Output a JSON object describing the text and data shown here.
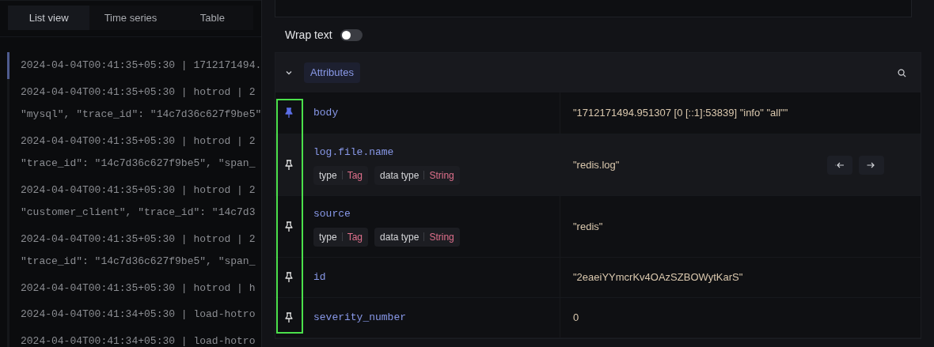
{
  "view_tabs": [
    {
      "label": "List view",
      "selected": true
    },
    {
      "label": "Time series",
      "selected": false
    },
    {
      "label": "Table",
      "selected": false
    }
  ],
  "log_entries": [
    {
      "lines": [
        "2024-04-04T00:41:35+05:30 | 1712171494."
      ],
      "selected": true
    },
    {
      "lines": [
        "2024-04-04T00:41:35+05:30 | hotrod | 2",
        "\"mysql\", \"trace_id\": \"14c7d36c627f9be5\""
      ],
      "selected": false
    },
    {
      "lines": [
        "2024-04-04T00:41:35+05:30 | hotrod | 2",
        "\"trace_id\": \"14c7d36c627f9be5\", \"span_"
      ],
      "selected": false
    },
    {
      "lines": [
        "2024-04-04T00:41:35+05:30 | hotrod | 2",
        "\"customer_client\", \"trace_id\": \"14c7d3"
      ],
      "selected": false
    },
    {
      "lines": [
        "2024-04-04T00:41:35+05:30 | hotrod | 2",
        "\"trace_id\": \"14c7d36c627f9be5\", \"span_"
      ],
      "selected": false
    },
    {
      "lines": [
        "2024-04-04T00:41:35+05:30 | hotrod | h"
      ],
      "selected": false
    },
    {
      "lines": [
        "2024-04-04T00:41:34+05:30 | load-hotro"
      ],
      "selected": false
    },
    {
      "lines": [
        "2024-04-04T00:41:34+05:30 | load-hotro"
      ],
      "selected": false
    }
  ],
  "wrap_text": {
    "label": "Wrap text",
    "on": false
  },
  "attributes": {
    "title": "Attributes",
    "expanded": true,
    "rows": [
      {
        "key": "body",
        "pinned": true,
        "hovered": false,
        "tags": [],
        "value": "\"1712171494.951307 [0 [::1]:53839] \"info\" \"all\"\""
      },
      {
        "key": "log.file.name",
        "pinned": false,
        "hovered": true,
        "tags": [
          {
            "label": "type",
            "value": "Tag"
          },
          {
            "label": "data type",
            "value": "String"
          }
        ],
        "value": "\"redis.log\""
      },
      {
        "key": "source",
        "pinned": false,
        "hovered": false,
        "tags": [
          {
            "label": "type",
            "value": "Tag"
          },
          {
            "label": "data type",
            "value": "String"
          }
        ],
        "value": "\"redis\""
      },
      {
        "key": "id",
        "pinned": false,
        "hovered": false,
        "tags": [],
        "value": "\"2eaeiYYmcrKv4OAzSZBOWytKarS\""
      },
      {
        "key": "severity_number",
        "pinned": false,
        "hovered": false,
        "tags": [],
        "value": "0"
      }
    ]
  }
}
